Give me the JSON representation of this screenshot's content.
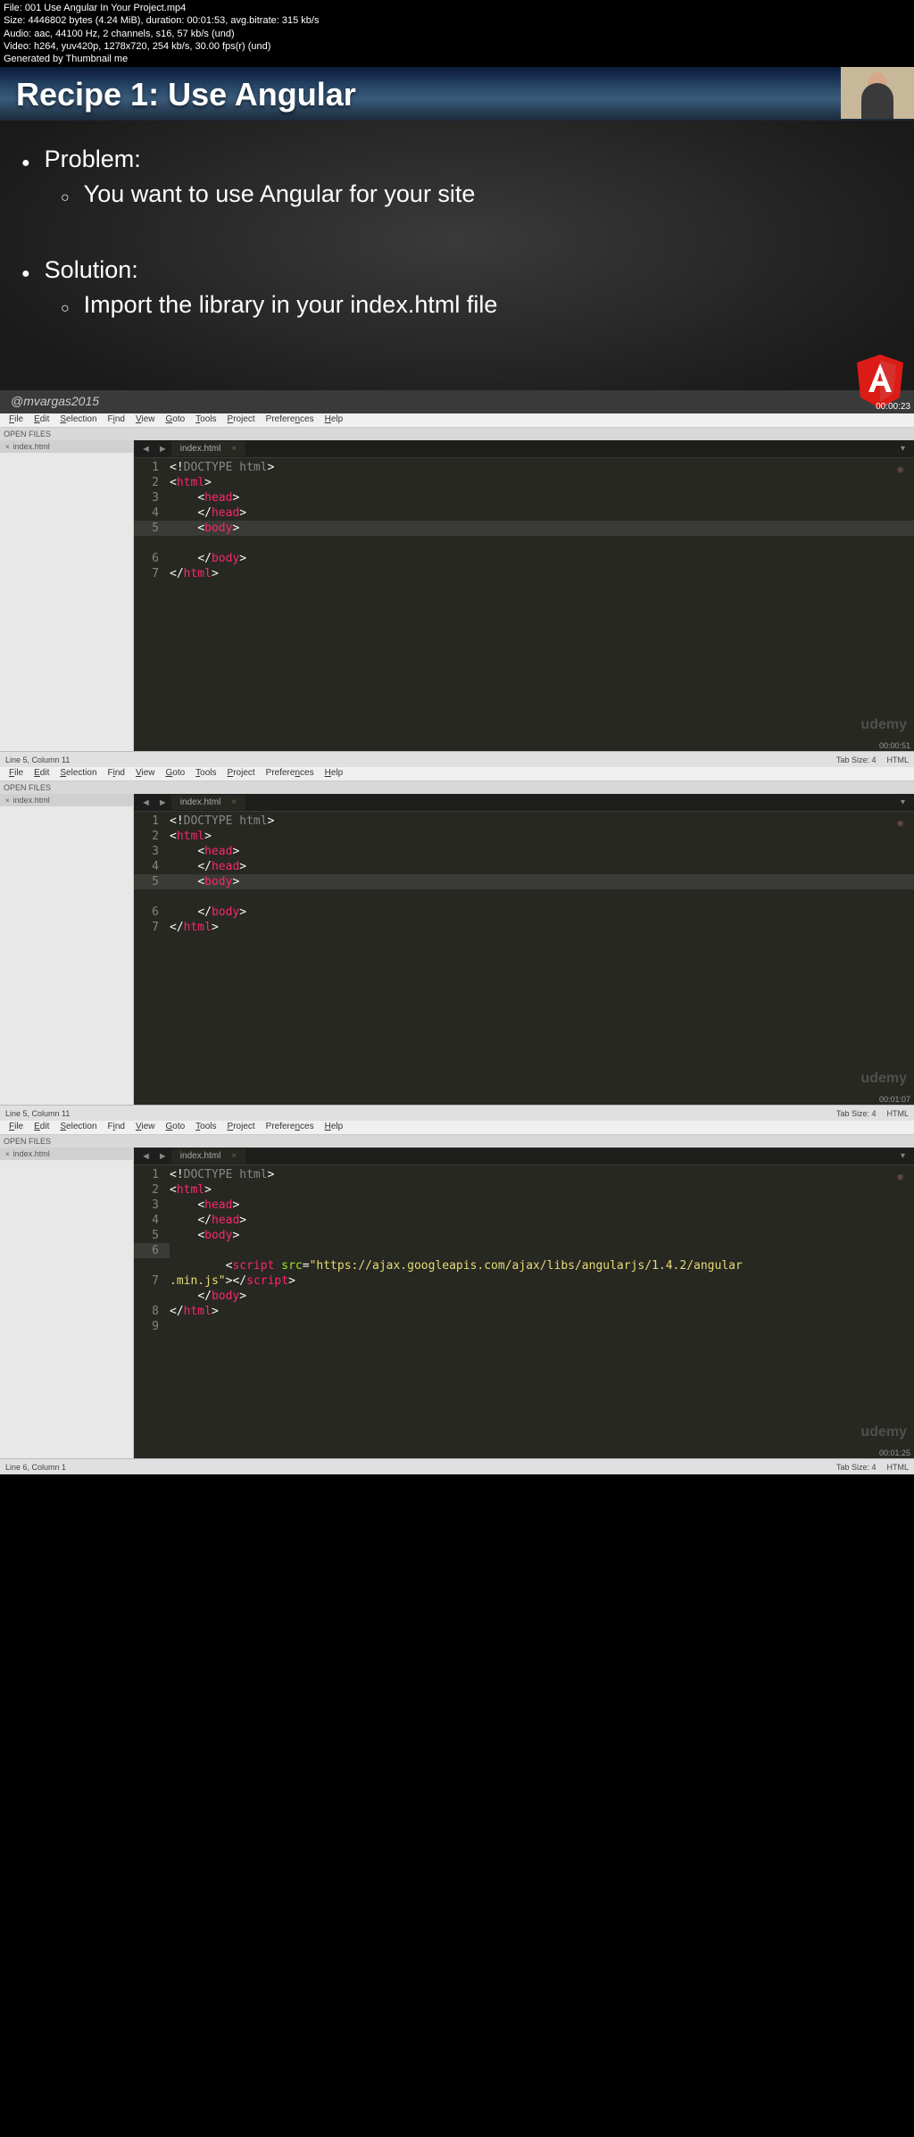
{
  "meta": {
    "file": "File: 001 Use Angular In Your Project.mp4",
    "size": "Size: 4446802 bytes (4.24 MiB), duration: 00:01:53, avg.bitrate: 315 kb/s",
    "audio": "Audio: aac, 44100 Hz, 2 channels, s16, 57 kb/s (und)",
    "video": "Video: h264, yuv420p, 1278x720, 254 kb/s, 30.00 fps(r) (und)",
    "gen": "Generated by Thumbnail me"
  },
  "slide": {
    "title": "Recipe 1: Use Angular",
    "problem_label": "Problem:",
    "problem_text": "You want to use Angular for your site",
    "solution_label": "Solution:",
    "solution_text": "Import the library in your index.html file",
    "handle": "@mvargas2015",
    "timestamp": "00:00:23"
  },
  "menu": {
    "file": "File",
    "edit": "Edit",
    "selection": "Selection",
    "find": "Find",
    "view": "View",
    "goto": "Goto",
    "tools": "Tools",
    "project": "Project",
    "preferences": "Preferences",
    "help": "Help"
  },
  "sidebar_panel": {
    "header": "OPEN FILES",
    "file": "index.html"
  },
  "tab": {
    "name": "index.html",
    "close": "×"
  },
  "code_basic": {
    "l1": "<!DOCTYPE html>",
    "html_open": "html",
    "html_close": "html",
    "head_open": "head",
    "head_close": "head",
    "body_open": "body",
    "body_close": "body"
  },
  "code_script": {
    "script_tag": "script",
    "src_attr": "src",
    "url_part1": "\"https://ajax.googleapis.com/ajax/libs/angularjs/1.4.2/angular",
    "url_part2": ".min.js\""
  },
  "status": {
    "f1": "Line 5, Column 11",
    "f2": "Line 5, Column 11",
    "f3": "Line 6, Column 1",
    "tab_size": "Tab Size: 4",
    "lang": "HTML"
  },
  "timestamps": {
    "f1": "00:00:51",
    "f2": "00:01:07",
    "f3": "00:01:25"
  },
  "udemy": "udemy"
}
